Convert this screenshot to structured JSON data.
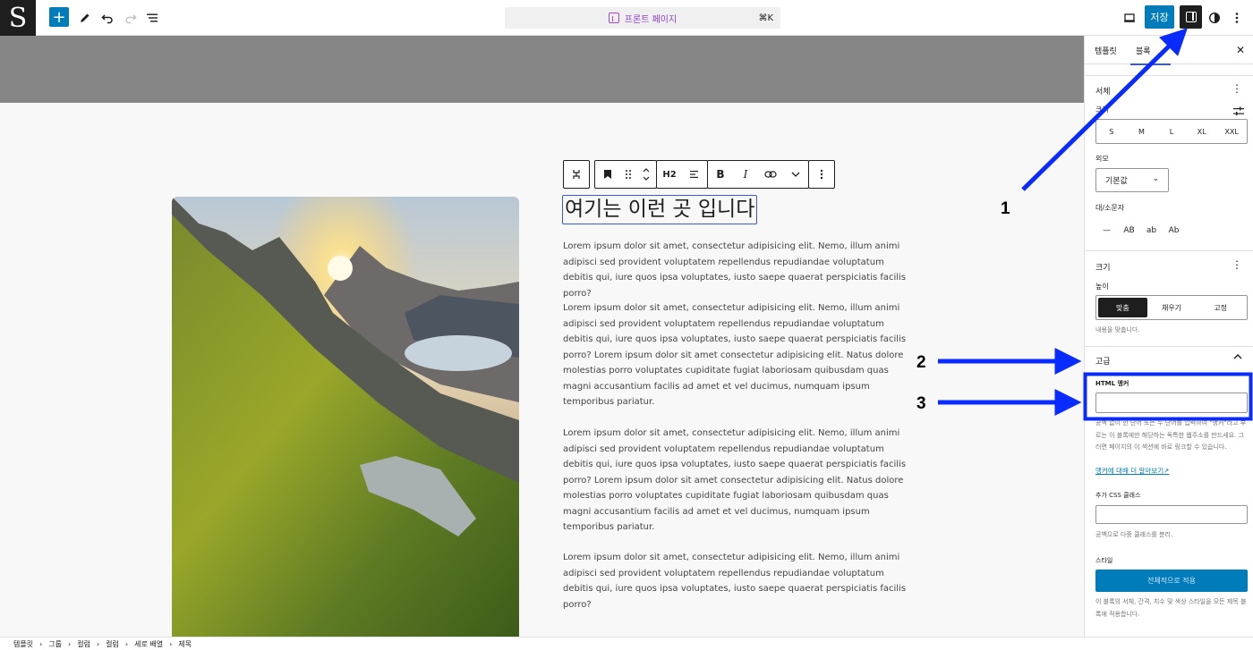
{
  "topbar": {
    "logo_letter": "S",
    "add_glyph": "+",
    "command": {
      "label": "프론트 페이지",
      "shortcut": "⌘K"
    },
    "save_label": "저장",
    "icons": [
      "site-logo",
      "add-block-icon",
      "pencil-icon",
      "undo-icon",
      "redo-icon",
      "list-view-icon",
      "template-icon",
      "desktop-preview-icon",
      "settings-panel-icon",
      "styles-icon",
      "kebab-menu-icon"
    ]
  },
  "canvas": {
    "heading": "여기는 이런 곳 입니다",
    "toolbar": {
      "heading_level": "H2",
      "bold": "B",
      "italic": "I"
    },
    "paragraphs": [
      "Lorem ipsum dolor sit amet, consectetur adipisicing elit. Nemo, illum animi adipisci sed provident voluptatem repellendus repudiandae voluptatum debitis qui, iure quos ipsa voluptates, iusto saepe quaerat perspiciatis facilis porro?",
      "Lorem ipsum dolor sit amet, consectetur adipisicing elit. Nemo, illum animi adipisci sed provident voluptatem repellendus repudiandae voluptatum debitis qui, iure quos ipsa voluptates, iusto saepe quaerat perspiciatis facilis porro? Lorem ipsum dolor sit amet consectetur adipisicing elit. Natus dolore molestias porro voluptates cupiditate fugiat laboriosam quibusdam quas magni accusantium facilis ad amet et vel ducimus, numquam ipsum temporibus pariatur.",
      "Lorem ipsum dolor sit amet, consectetur adipisicing elit. Nemo, illum animi adipisci sed provident voluptatem repellendus repudiandae voluptatum debitis qui, iure quos ipsa voluptates, iusto saepe quaerat perspiciatis facilis porro? Lorem ipsum dolor sit amet consectetur adipisicing elit. Natus dolore molestias porro voluptates cupiditate fugiat laboriosam quibusdam quas magni accusantium facilis ad amet et vel ducimus, numquam ipsum temporibus pariatur.",
      "Lorem ipsum dolor sit amet, consectetur adipisicing elit. Nemo, illum animi adipisci sed provident voluptatem repellendus repudiandae voluptatum debitis qui, iure quos ipsa voluptates, iusto saepe quaerat perspiciatis facilis porro?"
    ]
  },
  "sidebar": {
    "tabs": [
      "템플릿",
      "블록"
    ],
    "active_tab": "블록",
    "close_glyph": "✕",
    "typography": {
      "title": "서체",
      "size_label": "크기",
      "sizes": [
        "S",
        "M",
        "L",
        "XL",
        "XXL"
      ],
      "appearance_label": "외모",
      "appearance_value": "기본값",
      "case_label": "대/소문자",
      "case_options": [
        "—",
        "AB",
        "ab",
        "Ab"
      ]
    },
    "dimensions": {
      "title": "크기",
      "height_label": "높이",
      "height_options": [
        "맞춤",
        "채우기",
        "고정"
      ],
      "height_selected": "맞춤",
      "help": "내용을 맞춥니다."
    },
    "advanced": {
      "title": "고급",
      "anchor_label": "HTML 앵커",
      "anchor_value": "",
      "anchor_help": "공백 없이 한 단어 또는 두 단어를 입력하여 \"앵커\"라고 부르는 이 블록에만 해당하는 독특한 웹주소를 만드세요. 그러면 페이지의 이 섹션에 바로 링크할 수 있습니다.",
      "anchor_link": "앵커에 대해 더 알아보기",
      "css_label": "추가 CSS 클래스",
      "css_value": "",
      "css_help": "공백으로 다중 클래스를 분리."
    },
    "style": {
      "title": "스타일",
      "apply_label": "전체적으로 적용",
      "help": "이 블록의 서체, 간격, 치수 및 색상 스타일을 모든 제목 블록에 적용합니다."
    }
  },
  "annotations": {
    "numbers": [
      "1",
      "2",
      "3"
    ],
    "color": "#0a2bff"
  },
  "breadcrumb": [
    "템플릿",
    "그룹",
    "컬럼",
    "컬럼",
    "세로 배열",
    "제목"
  ],
  "colors": {
    "accent": "#007cba",
    "selection": "#3858e9",
    "annotation": "#0a2bff"
  }
}
